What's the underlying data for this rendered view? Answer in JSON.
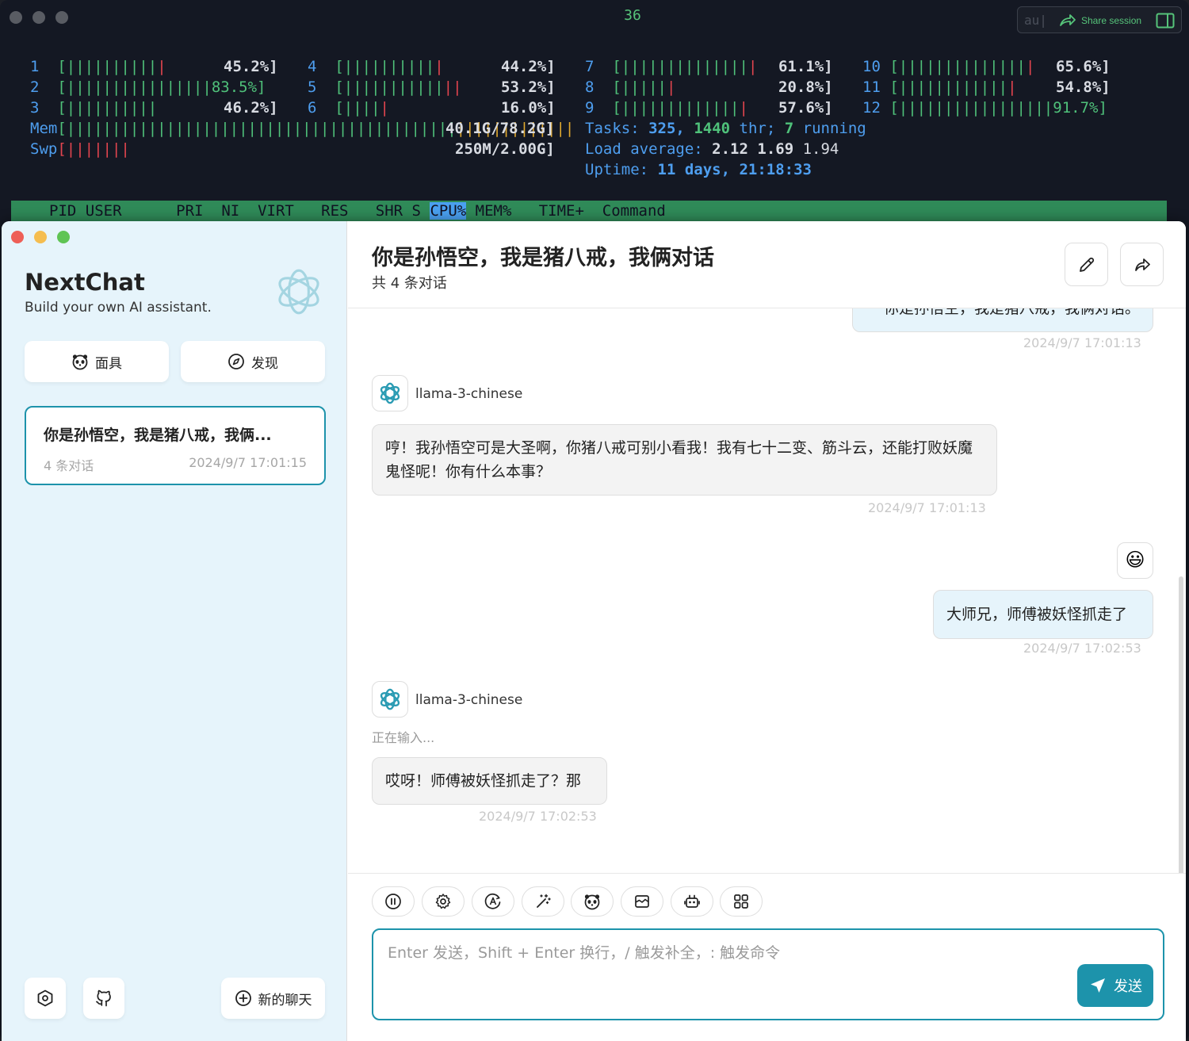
{
  "terminal": {
    "title": "36",
    "share": {
      "dim_text": "au|",
      "label": "Share session"
    },
    "cpus": [
      {
        "id": "1",
        "bar": "[||||||||||",
        "bar_extra": "|",
        "pct": "45.2%]"
      },
      {
        "id": "2",
        "bar": "[||||||||||||||||",
        "bar_extra": "83.5%]",
        "pct": ""
      },
      {
        "id": "3",
        "bar": "[||||||||||",
        "bar_extra": "",
        "pct": "46.2%]"
      },
      {
        "id": "4",
        "bar": "[||||||||||",
        "bar_extra": "|",
        "pct": "44.2%]"
      },
      {
        "id": "5",
        "bar": "[|||||||||||",
        "bar_extra": "||",
        "pct": "53.2%]"
      },
      {
        "id": "6",
        "bar": "[||||",
        "bar_extra": "|",
        "pct": "16.0%]"
      },
      {
        "id": "7",
        "bar": "[||||||||||||||",
        "bar_extra": "|",
        "pct": "61.1%]"
      },
      {
        "id": "8",
        "bar": "[|||||",
        "bar_extra": "|",
        "pct": "20.8%]"
      },
      {
        "id": "9",
        "bar": "[|||||||||||||",
        "bar_extra": "|",
        "pct": "57.6%]"
      },
      {
        "id": "10",
        "bar": "[||||||||||||||",
        "bar_extra": "|",
        "pct": "65.6%]"
      },
      {
        "id": "11",
        "bar": "[||||||||||||",
        "bar_extra": "|",
        "pct": "54.8%]"
      },
      {
        "id": "12",
        "bar": "[|||||||||||||||||",
        "bar_extra": "91.7%]",
        "pct": ""
      }
    ],
    "mem": {
      "label": "Mem",
      "bar_green": "[|||||||||||||||||||||||||||||||||||||||||||",
      "bar_yellow": "|||||||||||||",
      "value": "40.1G/78.2G]"
    },
    "swp": {
      "label": "Swp",
      "bar": "[|||||||",
      "value": "250M/2.00G]"
    },
    "tasks": {
      "label": "Tasks:",
      "count": "325,",
      "threads": "1440",
      "thr_label": "thr;",
      "running": "7",
      "running_label": "running"
    },
    "load": {
      "label": "Load average:",
      "v1": "2.12",
      "v5": "1.69",
      "v15": "1.94"
    },
    "uptime": {
      "label": "Uptime:",
      "value": "11 days, 21:18:33"
    },
    "columns": {
      "before": "PID USER      PRI  NI  VIRT   RES   SHR S ",
      "active": "CPU%",
      "after": " MEM%   TIME+  Command"
    }
  },
  "sidebar": {
    "title": "NextChat",
    "subtitle": "Build your own AI assistant.",
    "mask_label": "面具",
    "discover_label": "发现",
    "chat_item": {
      "title": "你是孙悟空，我是猪八戒，我俩...",
      "count": "4 条对话",
      "date": "2024/9/7 17:01:15"
    },
    "new_chat_label": "新的聊天"
  },
  "chat": {
    "title": "你是孙悟空，我是猪八戒，我俩对话",
    "subtitle": "共 4 条对话",
    "messages": [
      {
        "role": "user",
        "text": "你是孙悟空，我是猪八戒，我俩对话。",
        "time": "2024/9/7 17:01:13"
      },
      {
        "role": "bot",
        "model": "llama-3-chinese",
        "text": "哼！我孙悟空可是大圣啊，你猪八戒可别小看我！我有七十二变、筋斗云，还能打败妖魔鬼怪呢！你有什么本事？",
        "time": "2024/9/7 17:01:13"
      },
      {
        "role": "user",
        "text": "大师兄，师傅被妖怪抓走了",
        "time": "2024/9/7 17:02:53"
      },
      {
        "role": "bot",
        "model": "llama-3-chinese",
        "status": "正在输入...",
        "text": "哎呀！师傅被妖怪抓走了？那",
        "time": "2024/9/7 17:02:53"
      }
    ],
    "user_avatar": "😃",
    "input_placeholder": "Enter 发送，Shift + Enter 换行，/ 触发补全，: 触发命令",
    "input_value": "",
    "send_label": "发送"
  },
  "colors": {
    "accent": "#1d93ab",
    "sidebar_bg": "#e6f4fb",
    "terminal_bg": "#141823",
    "htop_header": "#2f8a58"
  }
}
